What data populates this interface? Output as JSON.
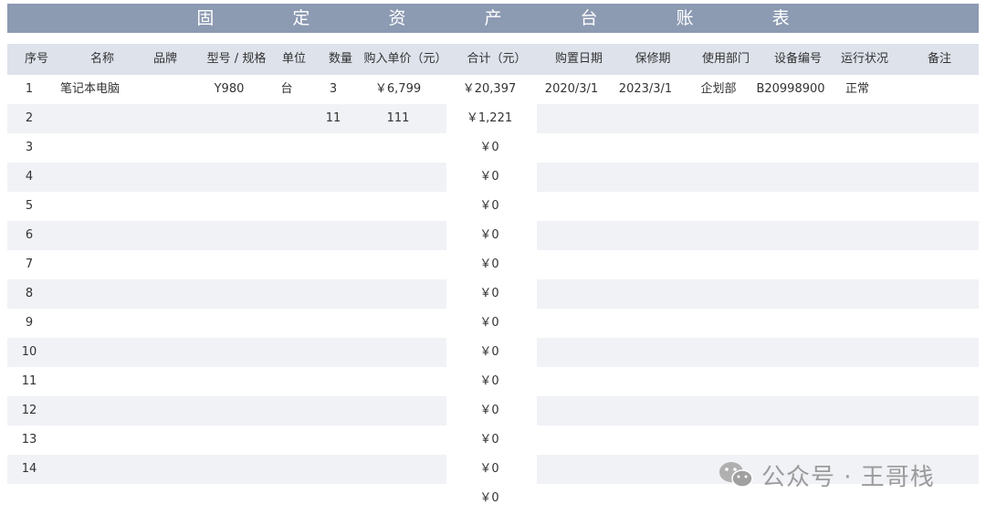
{
  "title": "固 定 资 产 台 账 表",
  "columns": [
    {
      "key": "no",
      "label": "序号"
    },
    {
      "key": "name",
      "label": "名称"
    },
    {
      "key": "brand",
      "label": "品牌"
    },
    {
      "key": "model",
      "label": "型号 / 规格"
    },
    {
      "key": "unit",
      "label": "单位"
    },
    {
      "key": "qty",
      "label": "数量"
    },
    {
      "key": "price",
      "label": "购入单价（元）"
    },
    {
      "key": "total",
      "label": "合计（元）"
    },
    {
      "key": "date",
      "label": "购置日期"
    },
    {
      "key": "warranty",
      "label": "保修期"
    },
    {
      "key": "dept",
      "label": "使用部门"
    },
    {
      "key": "code",
      "label": "设备编号"
    },
    {
      "key": "status",
      "label": "运行状况"
    },
    {
      "key": "note",
      "label": "备注"
    }
  ],
  "rows": [
    {
      "no": "1",
      "name": "笔记本电脑",
      "brand": "",
      "model": "Y980",
      "unit": "台",
      "qty": "3",
      "price": "￥6,799",
      "total": "￥20,397",
      "date": "2020/3/1",
      "warranty": "2023/3/1",
      "dept": "企划部",
      "code": "B20998900",
      "status": "正常",
      "note": ""
    },
    {
      "no": "2",
      "name": "",
      "brand": "",
      "model": "",
      "unit": "",
      "qty": "11",
      "price": "111",
      "total": "￥1,221",
      "date": "",
      "warranty": "",
      "dept": "",
      "code": "",
      "status": "",
      "note": ""
    },
    {
      "no": "3",
      "total": "￥0"
    },
    {
      "no": "4",
      "total": "￥0"
    },
    {
      "no": "5",
      "total": "￥0"
    },
    {
      "no": "6",
      "total": "￥0"
    },
    {
      "no": "7",
      "total": "￥0"
    },
    {
      "no": "8",
      "total": "￥0"
    },
    {
      "no": "9",
      "total": "￥0"
    },
    {
      "no": "10",
      "total": "￥0"
    },
    {
      "no": "11",
      "total": "￥0"
    },
    {
      "no": "12",
      "total": "￥0"
    },
    {
      "no": "13",
      "total": "￥0"
    },
    {
      "no": "14",
      "total": "￥0"
    },
    {
      "no": "",
      "total": "￥0"
    }
  ],
  "watermark": {
    "text": "公众号 · 王哥栈",
    "icon": "wechat-icon"
  },
  "colors": {
    "title_bg": "#8c9ab2",
    "header_bg": "#dde2eb",
    "stripe": "#f0f2f6"
  }
}
